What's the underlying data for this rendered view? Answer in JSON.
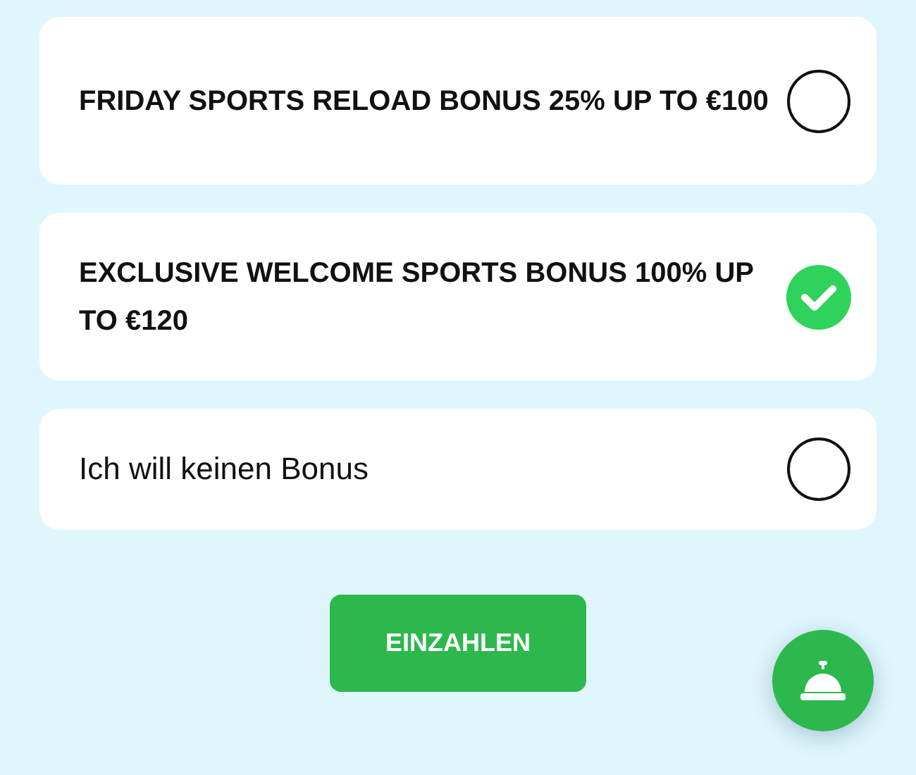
{
  "options": [
    {
      "kind": "bonus",
      "label": "FRIDAY SPORTS RELOAD BONUS 25% UP TO €100",
      "selected": false
    },
    {
      "kind": "bonus",
      "label": "EXCLUSIVE WELCOME SPORTS BONUS 100% UP TO €120",
      "selected": true
    },
    {
      "kind": "plain",
      "label": "Ich will keinen Bonus",
      "selected": false
    }
  ],
  "deposit_button": {
    "label": "EINZAHLEN"
  }
}
